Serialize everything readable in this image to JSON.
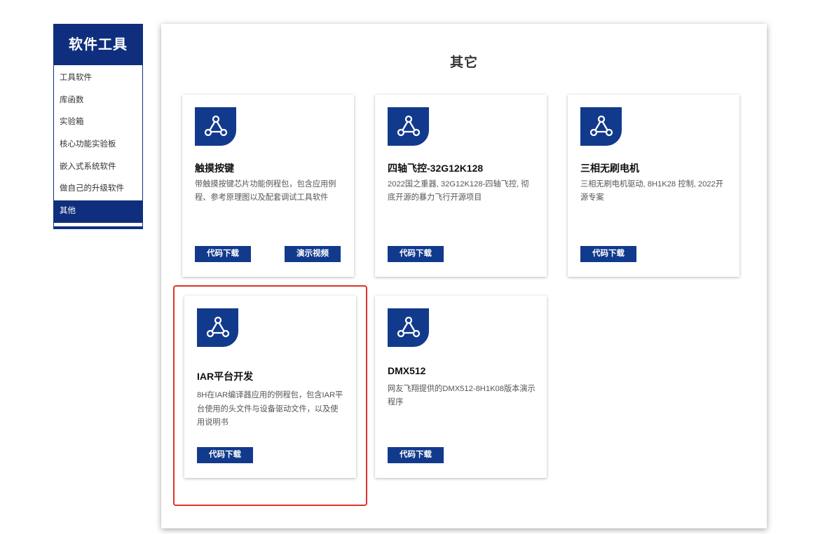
{
  "sidebar": {
    "title": "软件工具",
    "items": [
      {
        "label": "工具软件"
      },
      {
        "label": "库函数"
      },
      {
        "label": "实验箱"
      },
      {
        "label": "核心功能实验板"
      },
      {
        "label": "嵌入式系统软件"
      },
      {
        "label": "做自己的升级软件"
      },
      {
        "label": "其他",
        "active": true
      }
    ]
  },
  "main": {
    "title": "其它",
    "icon": "network-triangle-icon",
    "cards": [
      {
        "title": "触摸按键",
        "desc": "带触摸按键芯片功能例程包，包含应用例程、参考原理图以及配套调试工具软件",
        "buttons": [
          "代码下载",
          "演示视频"
        ]
      },
      {
        "title": "四轴飞控-32G12K128",
        "desc": "2022国之重器, 32G12K128-四轴飞控, 彻底开源的暴力飞行开源项目",
        "buttons": [
          "代码下载"
        ]
      },
      {
        "title": "三相无刷电机",
        "desc": "三相无刷电机驱动, 8H1K28 控制, 2022开源专案",
        "buttons": [
          "代码下载"
        ]
      },
      {
        "title": "IAR平台开发",
        "desc": "8H在IAR编译器应用的例程包，包含IAR平台使用的头文件与设备驱动文件，以及使用说明书",
        "buttons": [
          "代码下载"
        ]
      },
      {
        "title": "DMX512",
        "desc": "网友飞翔提供的DMX512-8H1K08版本演示程序",
        "buttons": [
          "代码下载"
        ]
      }
    ]
  },
  "colors": {
    "brand": "#123a8c",
    "highlight": "#e0312b"
  }
}
